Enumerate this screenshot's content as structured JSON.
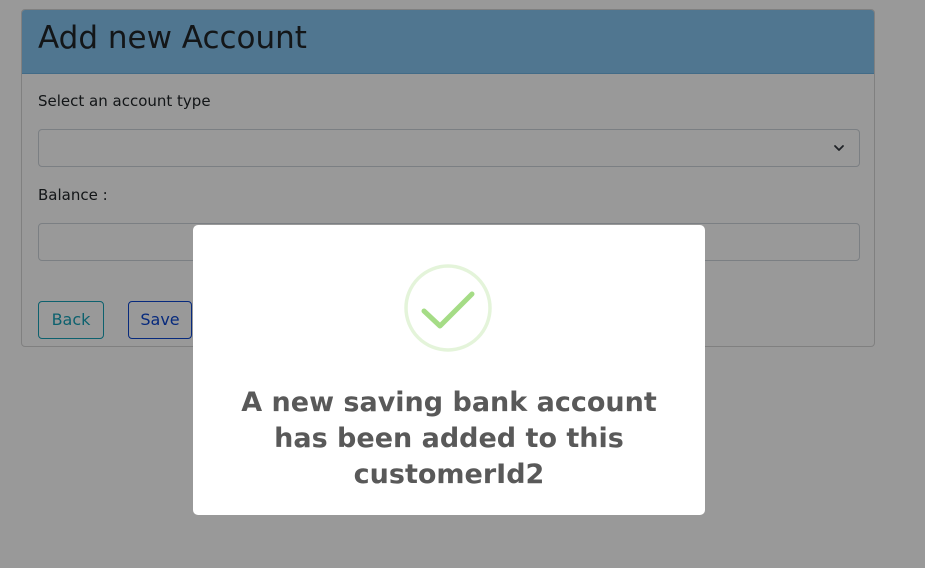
{
  "form": {
    "title": "Add new Account",
    "account_type_label": "Select an account type",
    "account_type_value": "",
    "balance_label": "Balance :",
    "balance_value": "",
    "back_label": "Back",
    "save_label": "Save"
  },
  "modal": {
    "icon": "success-check-icon",
    "message": "A new saving bank account has been added to this customerId2"
  },
  "colors": {
    "header_bg": "#86c5f1",
    "back_button": "#17a2b8",
    "save_button": "#0d47d1",
    "success_check": "#a5dc86"
  }
}
